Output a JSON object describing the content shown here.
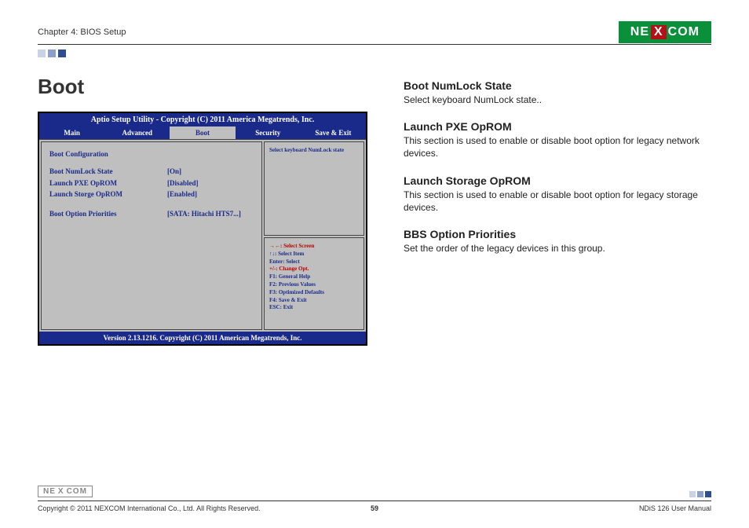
{
  "header": {
    "chapter": "Chapter 4: BIOS Setup",
    "logo_pre": "NE",
    "logo_x": "X",
    "logo_post": "COM"
  },
  "page_title": "Boot",
  "bios": {
    "title": "Aptio Setup Utility - Copyright (C) 2011 America Megatrends, Inc.",
    "tabs": {
      "main": "Main",
      "advanced": "Advanced",
      "boot": "Boot",
      "security": "Security",
      "saveexit": "Save & Exit"
    },
    "section_header": "Boot Configuration",
    "items": [
      {
        "k": "Boot NumLock State",
        "v": "[On]"
      },
      {
        "k": "Launch PXE OpROM",
        "v": "[Disabled]"
      },
      {
        "k": "Launch Storge OpROM",
        "v": "[Enabled]"
      }
    ],
    "priority": {
      "k": "Boot Option Priorities",
      "v": "[SATA: Hitachi HTS7...]"
    },
    "help": "Select keyboard NumLock state",
    "keys": {
      "l1a": "→←: Select Screen",
      "l2": "↑↓: Select Item",
      "l3": "Enter: Select",
      "l4a": "+/-: Change Opt.",
      "l5": "F1: General Help",
      "l6": "F2: Previous Values",
      "l7": "F3: Optimized Defaults",
      "l8": "F4: Save & Exit",
      "l9": "ESC: Exit"
    },
    "footer": "Version 2.13.1216. Copyright (C) 2011 American Megatrends, Inc."
  },
  "right": {
    "h1": "Boot NumLock State",
    "p1": "Select keyboard NumLock state..",
    "h2": "Launch PXE OpROM",
    "p2": "This section is used to enable or disable boot option for legacy network devices.",
    "h3": "Launch Storage OpROM",
    "p3": "This section is used to enable or disable boot option for legacy storage devices.",
    "h4": "BBS Option Priorities",
    "p4": "Set the order of the legacy devices in this group."
  },
  "footer": {
    "copyright": "Copyright © 2011 NEXCOM International Co., Ltd. All Rights Reserved.",
    "page": "59",
    "manual": "NDiS 126 User Manual"
  }
}
